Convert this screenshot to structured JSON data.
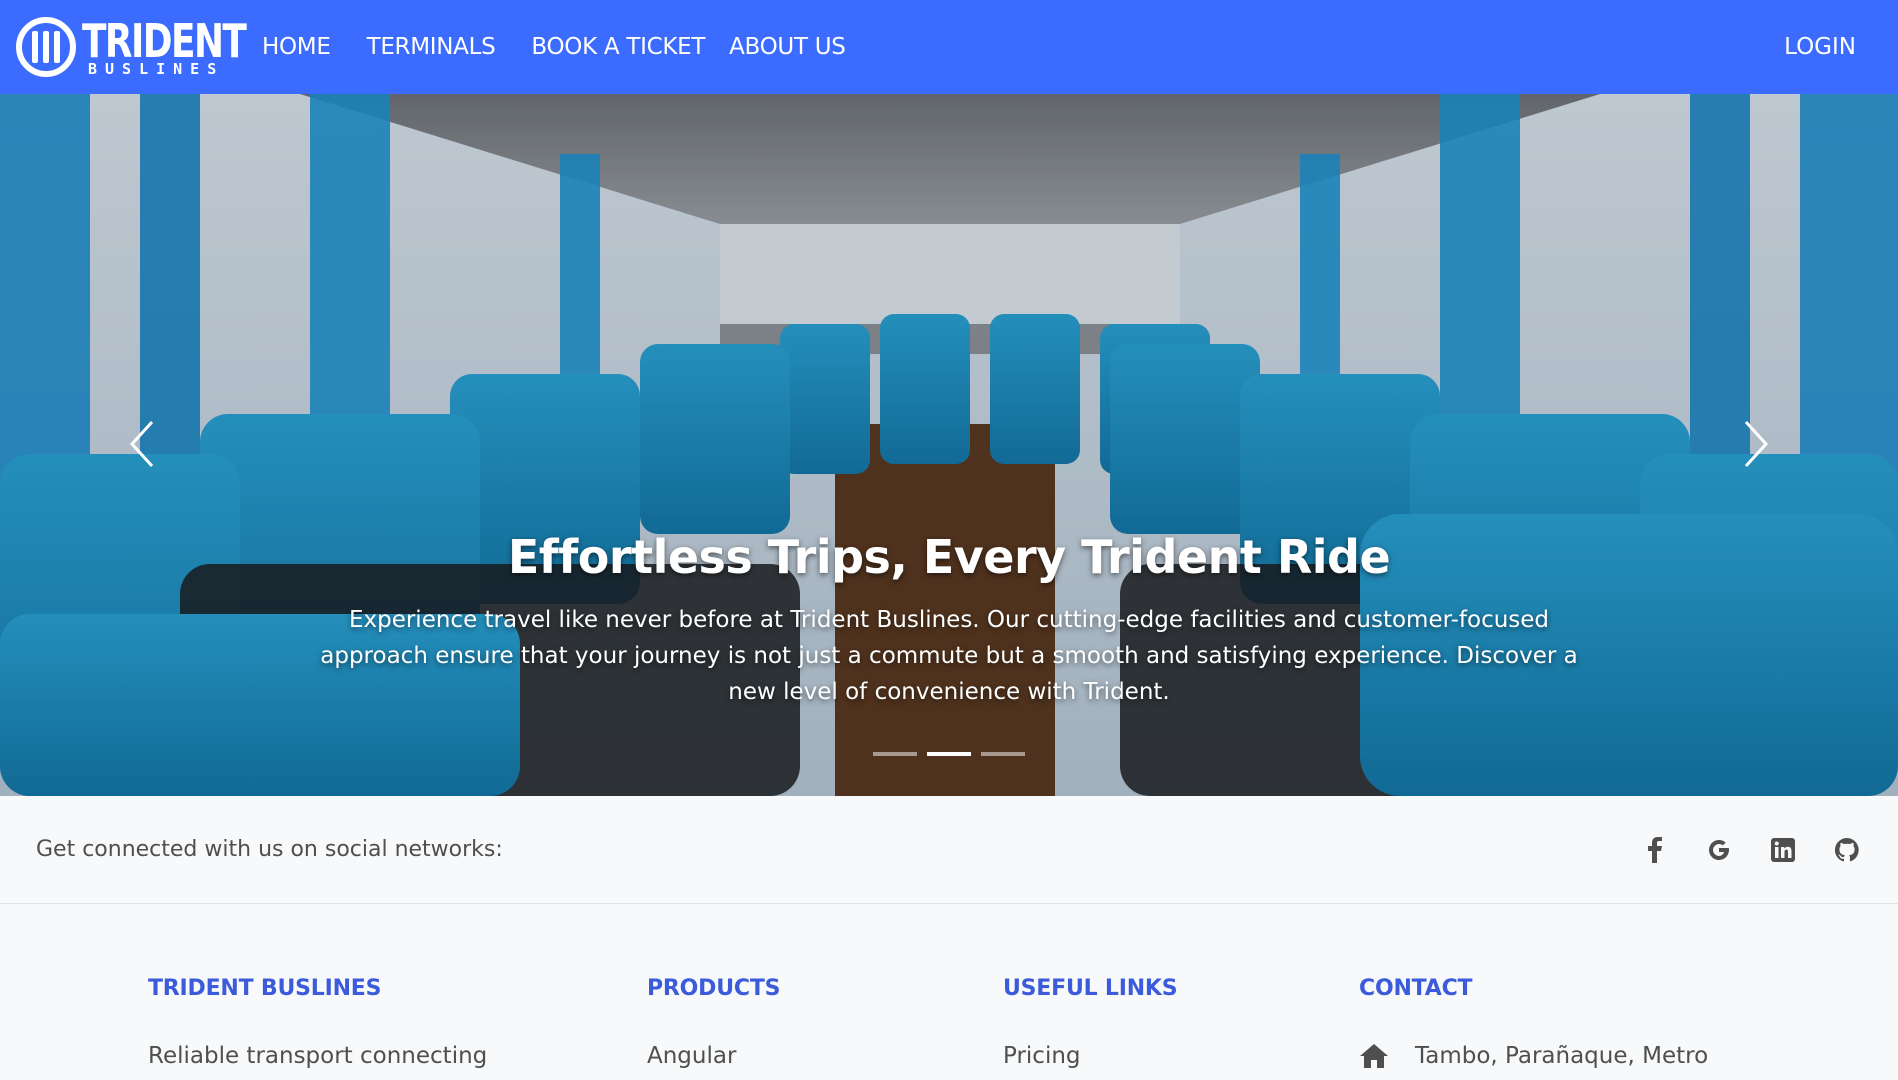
{
  "brand": {
    "title": "TRIDENT",
    "subtitle": "BUSLINES",
    "color": "#3b6cff"
  },
  "nav": {
    "links": [
      {
        "label": "HOME"
      },
      {
        "label": "TERMINALS"
      },
      {
        "label": "BOOK A TICKET"
      },
      {
        "label": "ABOUT US"
      }
    ],
    "login_label": "LOGIN"
  },
  "hero": {
    "title": "Effortless Trips, Every Trident Ride",
    "text": "Experience travel like never before at Trident Buslines. Our cutting-edge facilities and customer-focused approach ensure that your journey is not just a commute but a smooth and satisfying experience. Discover a new level of convenience with Trident.",
    "active_slide": 2,
    "slide_count": 3,
    "prev_icon": "chevron-left-icon",
    "next_icon": "chevron-right-icon"
  },
  "social": {
    "text": "Get connected with us on social networks:",
    "icons": [
      "facebook-icon",
      "google-icon",
      "linkedin-icon",
      "github-icon"
    ]
  },
  "footer": {
    "columns": [
      {
        "heading": "TRIDENT BUSLINES",
        "first_item": "Reliable transport connecting"
      },
      {
        "heading": "PRODUCTS",
        "first_item": "Angular"
      },
      {
        "heading": "USEFUL LINKS",
        "first_item": "Pricing"
      },
      {
        "heading": "CONTACT",
        "first_item": "Tambo, Parañaque, Metro",
        "icon": "home-icon"
      }
    ],
    "heading_color": "#3b5bdb"
  }
}
